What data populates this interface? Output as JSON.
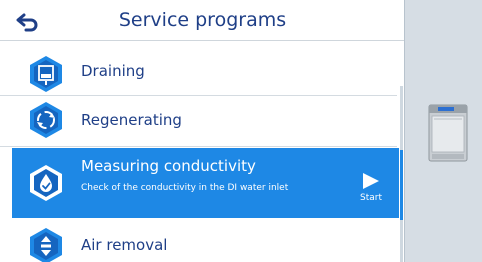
{
  "header": {
    "title": "Service programs",
    "back_icon": "back-arrow-icon"
  },
  "programs": [
    {
      "label": "Draining",
      "icon": "draining-icon"
    },
    {
      "label": "Regenerating",
      "icon": "regenerating-icon"
    },
    {
      "label": "Measuring conductivity",
      "icon": "conductivity-drop-icon",
      "description": "Check of the conductivity in the DI water inlet",
      "selected": true
    },
    {
      "label": "Air removal",
      "icon": "air-removal-icon"
    }
  ],
  "start": {
    "label": "Start",
    "icon": "play-icon"
  },
  "colors": {
    "accent": "#1e88e5",
    "text": "#1f3f87",
    "icon_dark": "#1f3f87"
  }
}
